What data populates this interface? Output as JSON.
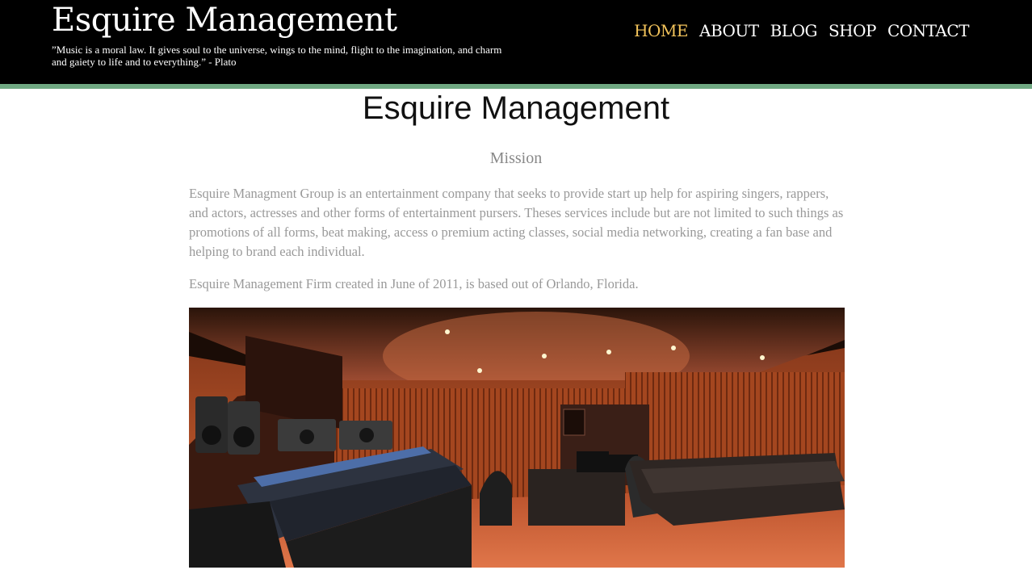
{
  "header": {
    "site_title": "Esquire Management",
    "quote": "”Music is a moral law. It gives soul to the universe, wings to the mind, flight to the imagination, and charm and gaiety to life and to everything.” - Plato",
    "nav": [
      {
        "label": "HOME",
        "active": true
      },
      {
        "label": "ABOUT",
        "active": false
      },
      {
        "label": "BLOG",
        "active": false
      },
      {
        "label": "SHOP",
        "active": false
      },
      {
        "label": "CONTACT",
        "active": false
      }
    ],
    "colors": {
      "background": "#000000",
      "stripe": "#6fa882",
      "active_nav": "#f1c25a"
    }
  },
  "main": {
    "heading": "Esquire Management",
    "subheading": "Mission",
    "paragraphs": [
      "Esquire Managment Group is an entertainment company that seeks to provide start up help for aspiring singers, rappers, and actors, actresses and other forms of entertainment pursers. Theses services include but are not limited to such things as promotions of all forms, beat making, access o premium acting classes, social media networking, creating a fan base and helping to brand each individual.",
      "Esquire Management Firm created in June of 2011, is based out of Orlando, Florida."
    ],
    "image": {
      "subject": "recording-studio-photo"
    }
  }
}
